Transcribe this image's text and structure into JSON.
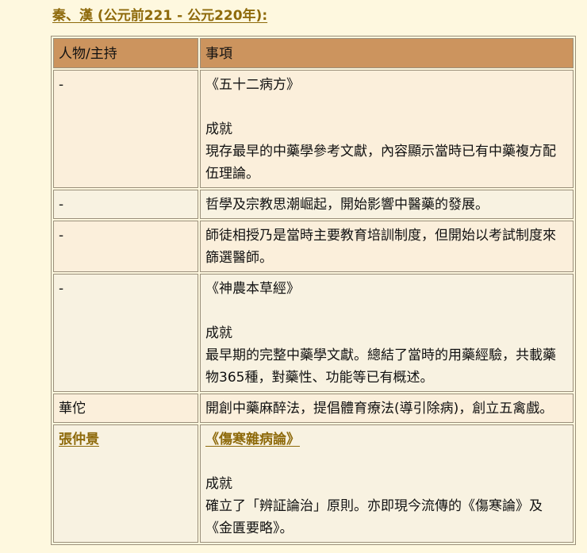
{
  "heading": "秦、漢 (公元前221 - 公元220年):",
  "table": {
    "headers": [
      "人物/主持",
      "事項"
    ],
    "rows": [
      {
        "person": "-",
        "book": "《五十二病方》",
        "achieve_label": "成就",
        "text": "現存最早的中藥學參考文獻，內容顯示當時已有中藥複方配伍理論。"
      },
      {
        "person": "-",
        "text": "哲學及宗教思潮崛起，開始影響中醫藥的發展。"
      },
      {
        "person": "-",
        "text": "師徒相授乃是當時主要教育培訓制度，但開始以考試制度來篩選醫師。"
      },
      {
        "person": "-",
        "book": "《神農本草經》",
        "achieve_label": "成就",
        "text": "最早期的完整中藥學文獻。總結了當時的用藥經驗，共載藥物365種，對藥性、功能等已有概述。"
      },
      {
        "person": "華佗",
        "text": "開創中藥麻醉法，提倡體育療法(導引除病)，創立五禽戲。"
      },
      {
        "person": "張仲景",
        "book": "《傷寒雜病論》",
        "achieve_label": "成就",
        "text": "確立了「辨証論治」原則。亦即現今流傳的《傷寒論》及《金匱要略》。"
      }
    ]
  }
}
